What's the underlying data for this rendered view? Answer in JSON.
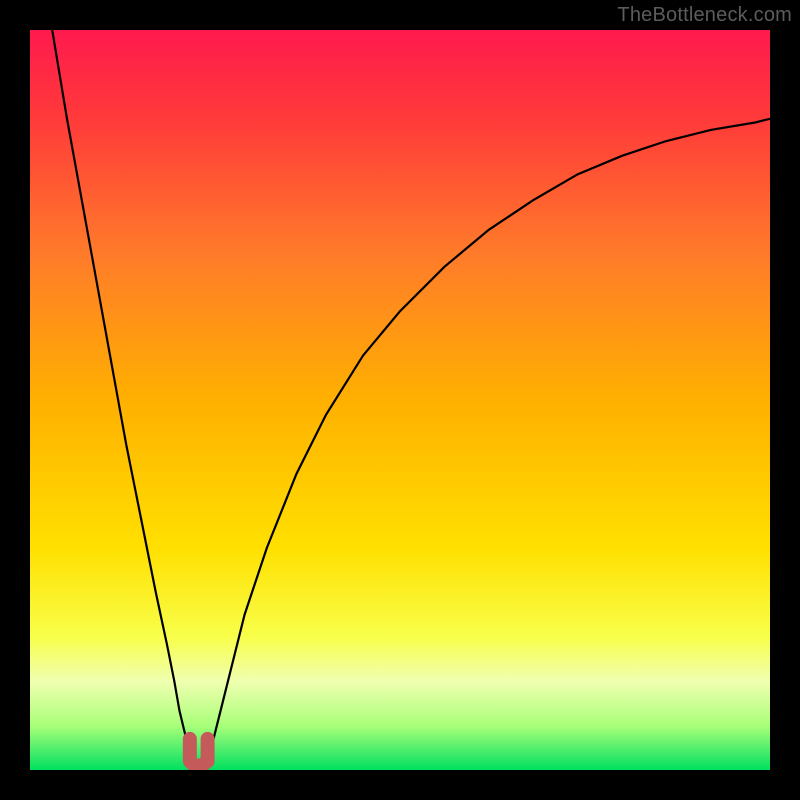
{
  "watermark": "TheBottleneck.com",
  "chart_data": {
    "type": "line",
    "title": "",
    "xlabel": "",
    "ylabel": "",
    "xlim": [
      0,
      100
    ],
    "ylim": [
      0,
      100
    ],
    "grid": false,
    "legend": null,
    "background_gradient": {
      "stops": [
        {
          "offset": 0.0,
          "color": "#ff1a4d"
        },
        {
          "offset": 0.12,
          "color": "#ff3a3a"
        },
        {
          "offset": 0.3,
          "color": "#ff7a2a"
        },
        {
          "offset": 0.5,
          "color": "#ffb000"
        },
        {
          "offset": 0.7,
          "color": "#ffe000"
        },
        {
          "offset": 0.82,
          "color": "#f8ff4a"
        },
        {
          "offset": 0.88,
          "color": "#f0ffb0"
        },
        {
          "offset": 0.94,
          "color": "#aaff7a"
        },
        {
          "offset": 1.0,
          "color": "#00e060"
        }
      ]
    },
    "series": [
      {
        "name": "left-branch",
        "color": "#000000",
        "stroke_width": 2.2,
        "x": [
          3,
          5,
          7,
          9,
          11,
          13,
          15,
          17,
          18.5,
          19.5,
          20.2,
          20.8,
          21.3,
          21.7,
          22.0
        ],
        "y": [
          100,
          88,
          77,
          66,
          55,
          44,
          34,
          24,
          17,
          12,
          8,
          5.5,
          3.5,
          2.2,
          1.5
        ]
      },
      {
        "name": "right-branch",
        "color": "#000000",
        "stroke_width": 2.2,
        "x": [
          24.0,
          24.5,
          25.5,
          27,
          29,
          32,
          36,
          40,
          45,
          50,
          56,
          62,
          68,
          74,
          80,
          86,
          92,
          98,
          100
        ],
        "y": [
          1.5,
          3,
          7,
          13,
          21,
          30,
          40,
          48,
          56,
          62,
          68,
          73,
          77,
          80.5,
          83,
          85,
          86.5,
          87.5,
          88
        ]
      },
      {
        "name": "marker-connector",
        "color": "#c45a5a",
        "stroke_width": 14,
        "linecap": "round",
        "x": [
          21.6,
          21.6,
          22.2,
          23.2,
          24.0,
          24.0
        ],
        "y": [
          4.2,
          1.2,
          0.6,
          0.6,
          1.2,
          4.2
        ]
      }
    ]
  }
}
